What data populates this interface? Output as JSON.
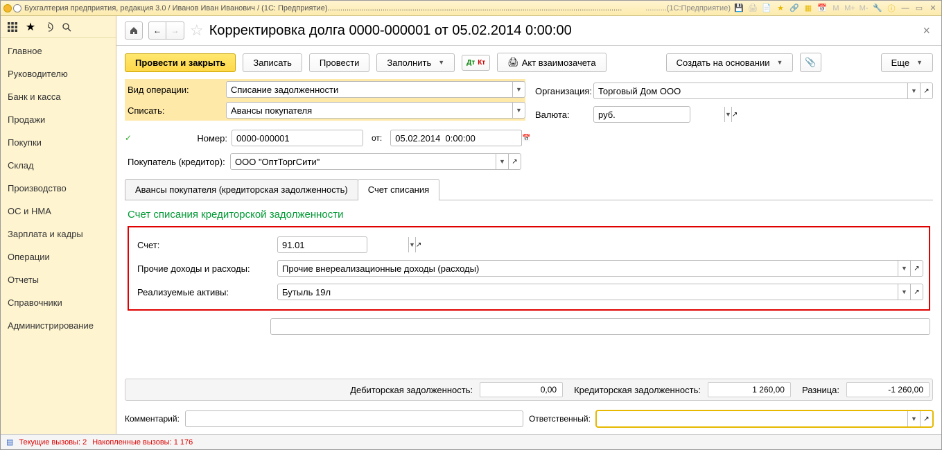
{
  "titlebar": {
    "title": "Бухгалтерия предприятия, редакция 3.0 / Иванов Иван Иванович / (1С: Предприятие)...........................................................................................................................................",
    "app_hint": "..........(1С:Предприятие)"
  },
  "sidebar": {
    "items": [
      "Главное",
      "Руководителю",
      "Банк и касса",
      "Продажи",
      "Покупки",
      "Склад",
      "Производство",
      "ОС и НМА",
      "Зарплата и кадры",
      "Операции",
      "Отчеты",
      "Справочники",
      "Администрирование"
    ]
  },
  "doc": {
    "title": "Корректировка долга 0000-000001 от 05.02.2014 0:00:00"
  },
  "toolbar": {
    "post_close": "Провести и закрыть",
    "write": "Записать",
    "post": "Провести",
    "fill": "Заполнить",
    "act": "Акт взаимозачета",
    "create_based": "Создать на основании",
    "more": "Еще"
  },
  "labels": {
    "operation_type": "Вид операции:",
    "write_off": "Списать:",
    "number": "Номер:",
    "from": "от:",
    "buyer": "Покупатель (кредитор):",
    "organization": "Организация:",
    "currency": "Валюта:",
    "account": "Счет:",
    "other_income": "Прочие доходы и расходы:",
    "assets": "Реализуемые активы:",
    "comment": "Комментарий:",
    "responsible": "Ответственный:",
    "debit": "Дебиторская задолженность:",
    "credit": "Кредиторская задолженность:",
    "diff": "Разница:"
  },
  "values": {
    "operation_type": "Списание задолженности",
    "write_off": "Авансы покупателя",
    "number": "0000-000001",
    "date": "05.02.2014  0:00:00",
    "buyer": "ООО \"ОптТоргСити\"",
    "organization": "Торговый Дом ООО",
    "currency": "руб.",
    "account": "91.01",
    "other_income": "Прочие внереализационные доходы (расходы)",
    "assets": "Бутыль 19л",
    "debit": "0,00",
    "credit": "1 260,00",
    "diff": "-1 260,00",
    "comment": "",
    "responsible": ""
  },
  "tabs": {
    "advances": "Авансы покупателя (кредиторская задолженность)",
    "writeoff_account": "Счет списания"
  },
  "section": {
    "title": "Счет списания кредиторской задолженности"
  },
  "status": {
    "current": "Текущие вызовы: 2",
    "accumulated": "Накопленные вызовы: 1 176"
  },
  "title_icons": {
    "m": "M",
    "mplus": "M+",
    "mminus": "M-"
  }
}
